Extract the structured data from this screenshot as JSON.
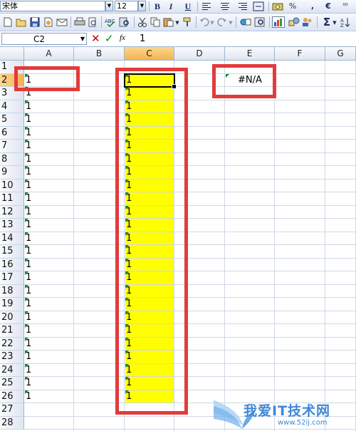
{
  "toolbar1": {
    "font_name": "宋体",
    "font_size": "12",
    "bold_label": "B",
    "italic_label": "I",
    "underline_label": "U",
    "percent_label": "%",
    "comma_label": ",",
    "euro_label": "€",
    "decimal_label": "⁰⁰"
  },
  "toolbar2": {
    "sum_label": "Σ"
  },
  "formula_bar": {
    "name_box": "C2",
    "cancel_label": "✕",
    "enter_label": "✓",
    "fx_label": "fx",
    "content": "1"
  },
  "columns": [
    "A",
    "B",
    "C",
    "D",
    "E",
    "F",
    "G"
  ],
  "active_column": "C",
  "rows": [
    "1",
    "2",
    "3",
    "4",
    "5",
    "6",
    "7",
    "8",
    "9",
    "10",
    "11",
    "12",
    "13",
    "14",
    "15",
    "16",
    "17",
    "18",
    "19",
    "20",
    "21",
    "22",
    "23",
    "24",
    "25",
    "26",
    "27",
    "28"
  ],
  "active_row": "2",
  "column_a_values": [
    "1",
    "1",
    "1",
    "1",
    "1",
    "1",
    "1",
    "1",
    "1",
    "1",
    "1",
    "1",
    "1",
    "1",
    "1",
    "1",
    "1",
    "1",
    "1",
    "1",
    "1",
    "1",
    "1",
    "1",
    "1"
  ],
  "column_c_values": [
    "1",
    "1",
    "1",
    "1",
    "1",
    "1",
    "1",
    "1",
    "1",
    "1",
    "1",
    "1",
    "1",
    "1",
    "1",
    "1",
    "1",
    "1",
    "1",
    "1",
    "1",
    "1",
    "1",
    "1",
    "1"
  ],
  "e2_value": "#N/A",
  "highlight_color": "#ffff00",
  "annotation_color": "#e23b3b",
  "watermark": {
    "text": "我爱IT技术网",
    "url": "www.52ij.com"
  }
}
